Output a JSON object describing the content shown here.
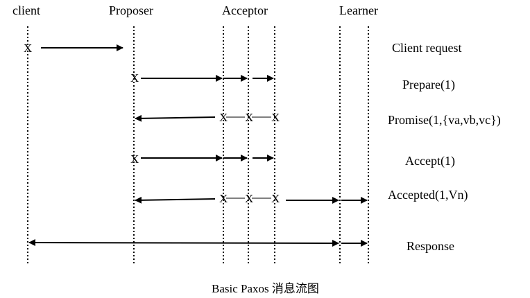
{
  "roles": {
    "client": "client",
    "proposer": "Proposer",
    "acceptor": "Acceptor",
    "learner": "Learner"
  },
  "messages": {
    "client_request": "Client request",
    "prepare": "Prepare(1)",
    "promise": "Promise(1,{va,vb,vc})",
    "accept": "Accept(1)",
    "accepted": "Accepted(1,Vn)",
    "response": "Response"
  },
  "event_marker": "X",
  "caption": "Basic Paxos 消息流图"
}
